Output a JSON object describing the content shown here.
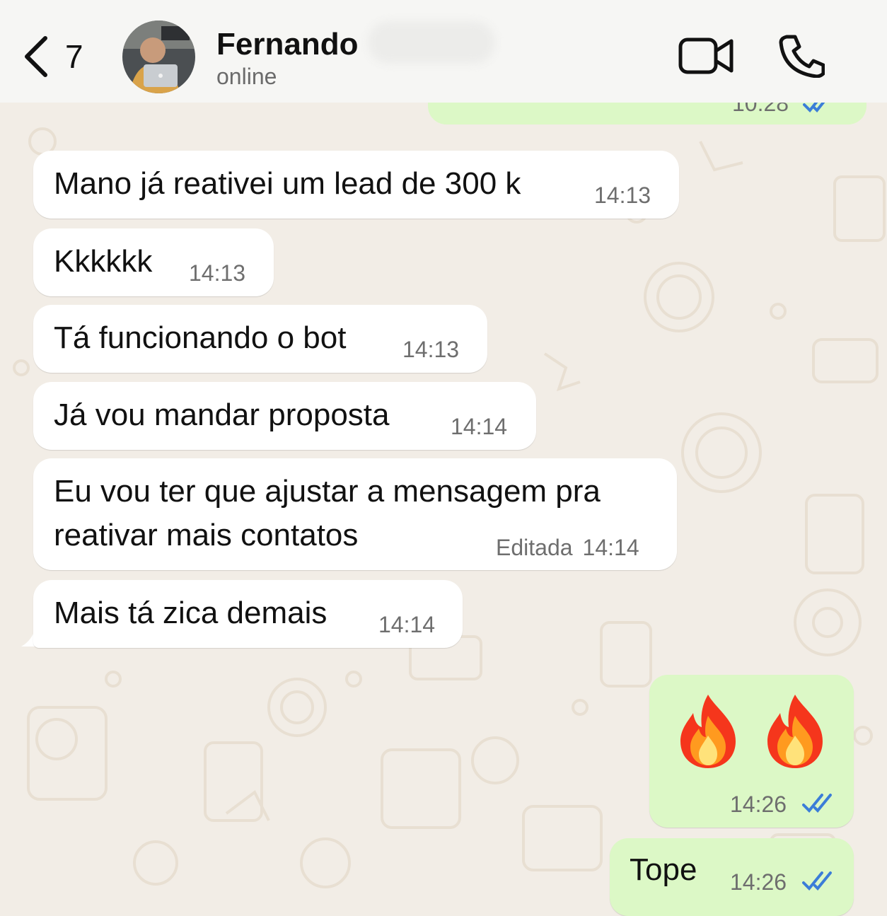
{
  "header": {
    "back_count": "7",
    "contact_name": "Fernando",
    "status": "online"
  },
  "clipped_message": {
    "time": "10:28",
    "status": "read"
  },
  "messages": [
    {
      "direction": "incoming",
      "text": "Mano já reativei um lead de 300 k",
      "time": "14:13"
    },
    {
      "direction": "incoming",
      "text": "Kkkkkk",
      "time": "14:13"
    },
    {
      "direction": "incoming",
      "text": "Tá funcionando o bot",
      "time": "14:13"
    },
    {
      "direction": "incoming",
      "text": "Já vou mandar proposta",
      "time": "14:14"
    },
    {
      "direction": "incoming",
      "text_lines": [
        "Eu vou ter que ajustar a mensagem pra",
        "reativar mais contatos"
      ],
      "edited_label": "Editada",
      "time": "14:14"
    },
    {
      "direction": "incoming",
      "text": "Mais tá zica demais",
      "time": "14:14"
    },
    {
      "direction": "outgoing",
      "emoji": "fire-fire",
      "time": "14:26",
      "status": "read"
    },
    {
      "direction": "outgoing",
      "text": "Tope",
      "time": "14:26",
      "status": "read"
    }
  ],
  "colors": {
    "incoming_bubble": "#FFFFFF",
    "outgoing_bubble": "#DCF8C6",
    "read_ticks": "#3B7DD8",
    "wallpaper": "#F2EDE6",
    "header_bg": "#F6F6F4"
  },
  "icons": {
    "back": "chevron-left-icon",
    "video": "video-camera-icon",
    "call": "phone-icon",
    "read_receipt": "double-check-icon"
  }
}
